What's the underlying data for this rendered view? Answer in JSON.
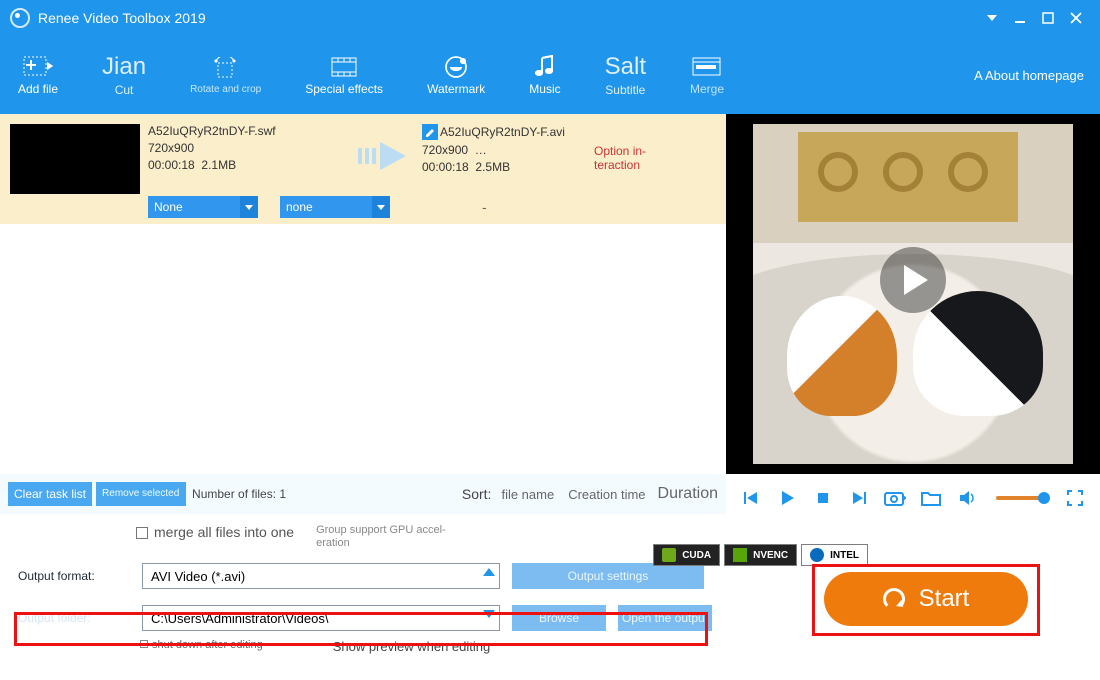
{
  "window": {
    "title": "Renee Video Toolbox 2019"
  },
  "toolbar": {
    "add_file": "Add file",
    "jian": "Jian",
    "cut": "Cut",
    "rotate_crop": "Rotate and crop",
    "effects": "Special effects",
    "watermark": "Watermark",
    "music": "Music",
    "salt": "Salt",
    "subtitle": "Subtitle",
    "merge": "Merge",
    "about": "A About homepage"
  },
  "file": {
    "src_name": "A52IuQRyR2tnDY-F.swf",
    "src_res": "720x900",
    "src_dur": "00:00:18",
    "src_size": "2.1MB",
    "dst_name": "A52IuQRyR2tnDY-F.avi",
    "dst_res": "720x900",
    "dst_more": "…",
    "dst_dur": "00:00:18",
    "dst_size": "2.5MB",
    "option_label": "Option in­teraction",
    "drop1": "None",
    "drop2": "none",
    "dash": "-"
  },
  "midbar": {
    "clear": "Clear task list",
    "remove": "Remove select­ed",
    "count_label": "Number of files: 1",
    "sort": "Sort:",
    "sort1": "file name",
    "sort2": "Creation time",
    "sort3": "Duration"
  },
  "bottom": {
    "merge_label": "merge all files into one",
    "gpu_text": "Group support GPU accel­eration",
    "cuda": "CUDA",
    "nvenc": "NVENC",
    "intel": "INTEL",
    "outfmt_label": "Output format:",
    "outfmt_value": "AVI Video (*.avi)",
    "outset": "Output settings",
    "outfolder_label": "Output folder:",
    "outfolder_value": "C:\\Users\\Administrator\\Videos\\",
    "browse": "Browse",
    "open": "Open the output",
    "shutdown": "shut down after editing",
    "preview": "Show preview when editing",
    "start": "Start"
  }
}
